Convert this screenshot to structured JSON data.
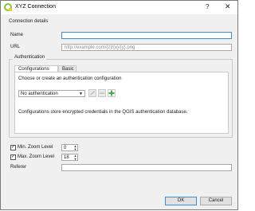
{
  "window": {
    "title": "XYZ Connection",
    "help": "?",
    "close": "✕"
  },
  "connection_details": {
    "section_label": "Connection details",
    "name_label": "Name",
    "name_value": "",
    "url_label": "URL",
    "url_placeholder": "http://example.com/{z}/{x}/{y}.png"
  },
  "authentication": {
    "group_title": "Authentication",
    "tabs": [
      "Configurations",
      "Basic"
    ],
    "prompt": "Choose or create an authentication configuration",
    "selected": "No authentication",
    "info": "Configurations store encrypted credentials in the QGIS authentication database."
  },
  "zoom": {
    "min_label": "Min. Zoom Level",
    "min_value": "0",
    "max_label": "Max. Zoom Level",
    "max_value": "18",
    "min_checked": true,
    "max_checked": true
  },
  "referer": {
    "label": "Referer",
    "value": ""
  },
  "buttons": {
    "ok": "OK",
    "cancel": "Cancel"
  },
  "colors": {
    "focus": "#3c8fd6",
    "dialog_bg": "#f0f0f0",
    "qgis_green": "#8ac33a"
  },
  "icons": {
    "app": "qgis-icon",
    "edit": "pencil-icon",
    "remove": "remove-icon",
    "add": "add-icon"
  }
}
